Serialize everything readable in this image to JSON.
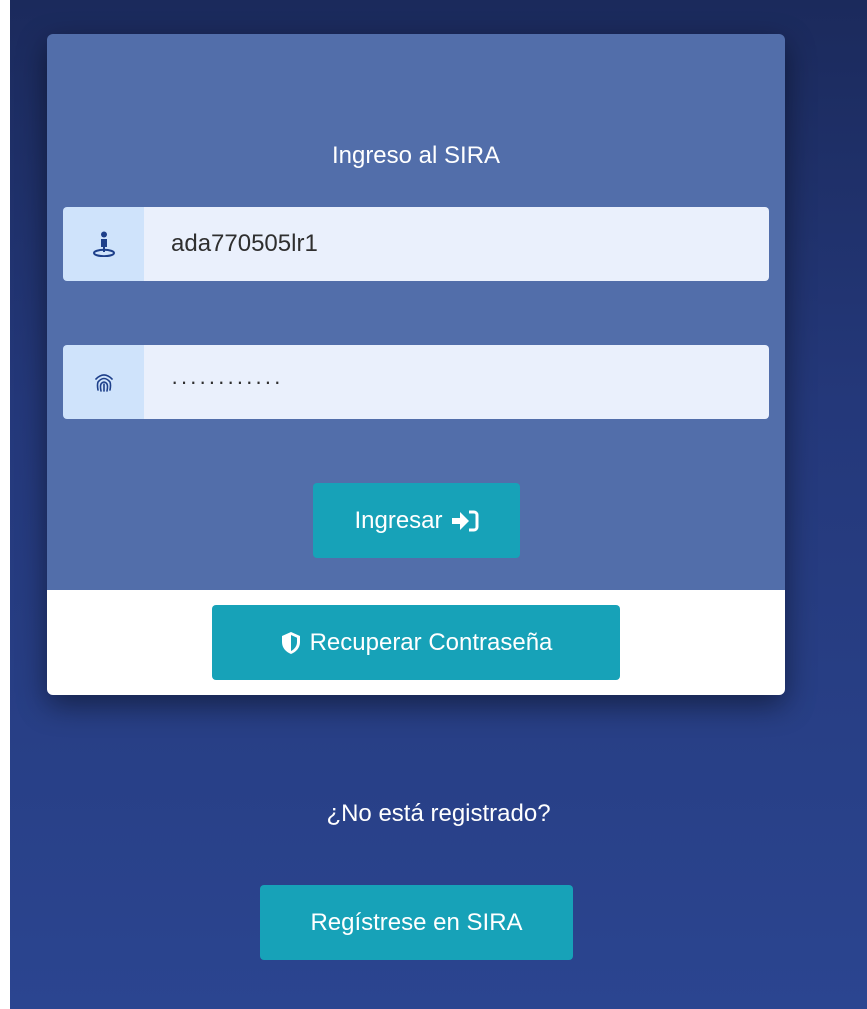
{
  "login": {
    "title": "Ingreso al SIRA",
    "username_value": "ada770505lr1",
    "password_value": "············",
    "submit_label": "Ingresar",
    "recover_label": "Recuperar Contraseña"
  },
  "register": {
    "question": "¿No está registrado?",
    "button_label": "Regístrese en SIRA"
  },
  "icons": {
    "user": "user-location-icon",
    "password": "fingerprint-icon",
    "submit": "sign-in-icon",
    "recover": "shield-icon"
  },
  "colors": {
    "card": "#526eaa",
    "button": "#17a2b8",
    "input_bg": "#eaf0fc",
    "addon_bg": "#cfe3fb"
  }
}
